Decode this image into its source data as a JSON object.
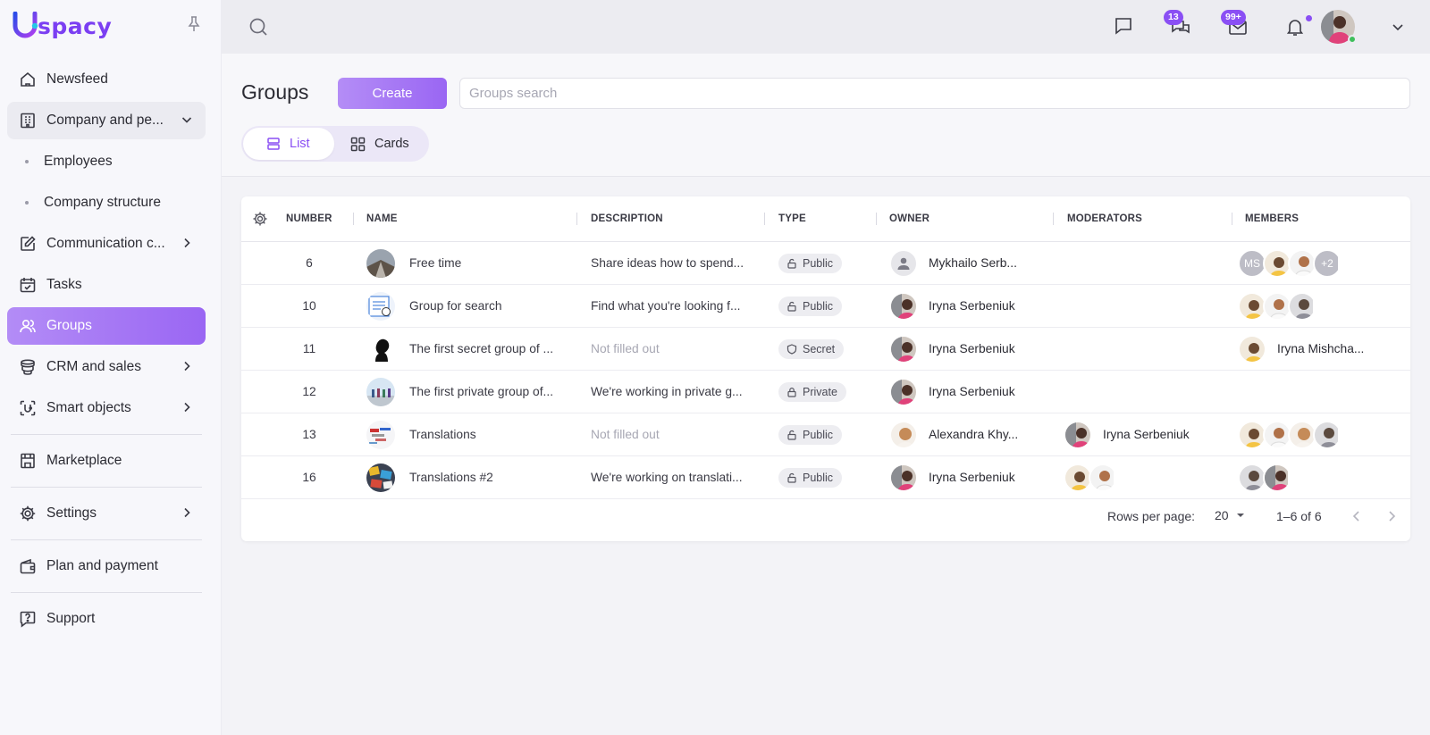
{
  "brand": {
    "logo_text": "spacy"
  },
  "sidebar": {
    "items": [
      {
        "label": "Newsfeed"
      },
      {
        "label": "Company and pe..."
      },
      {
        "label": "Employees"
      },
      {
        "label": "Company structure"
      },
      {
        "label": "Communication c..."
      },
      {
        "label": "Tasks"
      },
      {
        "label": "Groups"
      },
      {
        "label": "CRM and sales"
      },
      {
        "label": "Smart objects"
      },
      {
        "label": "Marketplace"
      },
      {
        "label": "Settings"
      },
      {
        "label": "Plan and payment"
      },
      {
        "label": "Support"
      }
    ]
  },
  "topbar": {
    "chats_badge": "13",
    "mail_badge": "99+"
  },
  "header": {
    "title": "Groups",
    "create_label": "Create",
    "search_placeholder": "Groups search",
    "view_list": "List",
    "view_cards": "Cards"
  },
  "table": {
    "columns": [
      "NUMBER",
      "NAME",
      "DESCRIPTION",
      "TYPE",
      "OWNER",
      "MODERATORS",
      "MEMBERS"
    ],
    "rows": [
      {
        "number": "6",
        "name": "Free time",
        "description": "Share ideas how to spend...",
        "type": "Public",
        "owner": "Mykhailo Serb...",
        "members_initials": "MS",
        "members_more": "+2"
      },
      {
        "number": "10",
        "name": "Group for search",
        "description": "Find what you're looking f...",
        "type": "Public",
        "owner": "Iryna Serbeniuk"
      },
      {
        "number": "11",
        "name": "The first secret group of ...",
        "description": "Not filled out",
        "type": "Secret",
        "owner": "Iryna Serbeniuk",
        "member_name": "Iryna Mishcha..."
      },
      {
        "number": "12",
        "name": "The first private group of...",
        "description": "We're working in private g...",
        "type": "Private",
        "owner": "Iryna Serbeniuk"
      },
      {
        "number": "13",
        "name": "Translations",
        "description": "Not filled out",
        "type": "Public",
        "owner": "Alexandra Khy...",
        "moderator": "Iryna Serbeniuk"
      },
      {
        "number": "16",
        "name": "Translations #2",
        "description": "We're working on translati...",
        "type": "Public",
        "owner": "Iryna Serbeniuk"
      }
    ]
  },
  "pagination": {
    "rows_per_page_label": "Rows per page:",
    "rows_per_page": "20",
    "range": "1–6 of 6"
  },
  "colors": {
    "accent": "#8a4ff4",
    "accent_light": "#b48df6"
  }
}
